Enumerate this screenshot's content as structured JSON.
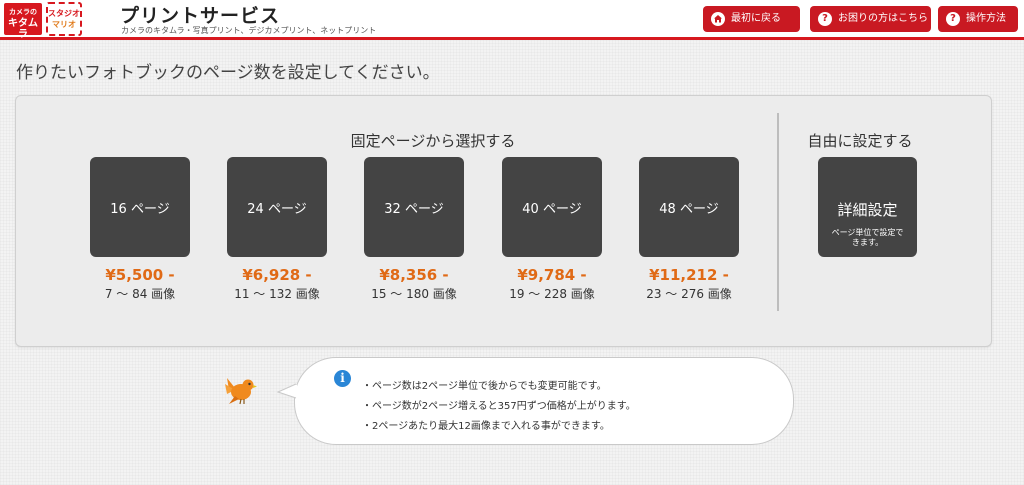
{
  "header": {
    "logo_kitamura_small": "カメラの",
    "logo_kitamura_big": "キタムラ",
    "logo_mario_line1": "スタジオ",
    "logo_mario_line2": "マリオ",
    "title": "プリントサービス",
    "subtitle": "カメラのキタムラ・写真プリント、デジカメプリント、ネットプリント",
    "buttons": [
      {
        "label": "最初に戻る",
        "icon": "home-icon"
      },
      {
        "label": "お困りの方はこちら",
        "icon": "question-icon",
        "glyph": "?"
      },
      {
        "label": "操作方法",
        "icon": "question-icon",
        "glyph": "?"
      }
    ]
  },
  "page_heading": "作りたいフォトブックのページ数を設定してください。",
  "fixed_section_title": "固定ページから選択する",
  "free_section_title": "自由に設定する",
  "page_options": [
    {
      "label": "16 ページ",
      "price": "¥5,500 -",
      "images": "7 ～ 84 画像"
    },
    {
      "label": "24 ページ",
      "price": "¥6,928 -",
      "images": "11 ～ 132 画像"
    },
    {
      "label": "32 ページ",
      "price": "¥8,356 -",
      "images": "15 ～ 180 画像"
    },
    {
      "label": "40 ページ",
      "price": "¥9,784 -",
      "images": "19 ～ 228 画像"
    },
    {
      "label": "48 ページ",
      "price": "¥11,212 -",
      "images": "23 ～ 276 画像"
    }
  ],
  "detail_button": {
    "label": "詳細設定",
    "sub": "ページ単位で設定できます。"
  },
  "info": {
    "icon_glyph": "i",
    "notes": [
      "・ページ数は2ページ単位で後からでも変更可能です。",
      "・ページ数が2ページ増えると357円ずつ価格が上がります。",
      "・2ページあたり最大12画像まで入れる事ができます。"
    ]
  },
  "colors": {
    "brand_red": "#c91922",
    "price_orange": "#e06a16",
    "tile_dark": "#444444",
    "info_blue": "#2a86d6"
  }
}
